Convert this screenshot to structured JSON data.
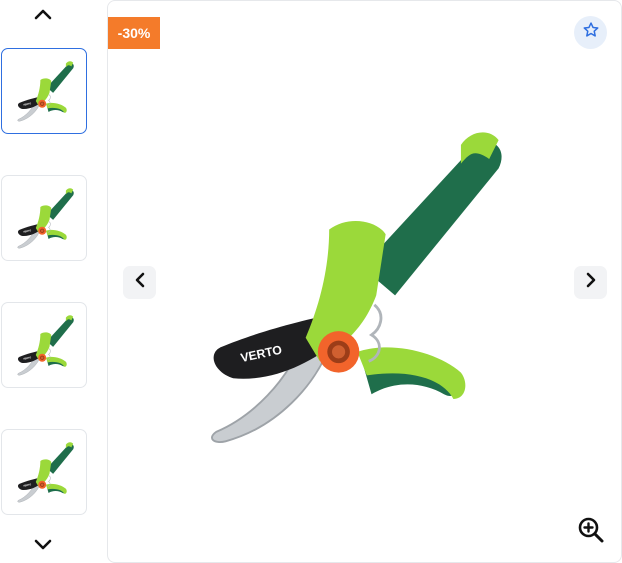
{
  "gallery": {
    "discount_badge": "-30%",
    "brand_text": "VERTO",
    "thumbnail_count": 4,
    "active_thumbnail": 1,
    "icons": {
      "thumb_up": "chevron-up-icon",
      "thumb_down": "chevron-down-icon",
      "prev": "chevron-left-icon",
      "next": "chevron-right-icon",
      "favorite": "star-icon",
      "zoom": "zoom-in-icon"
    },
    "colors": {
      "badge": "#f47b2a",
      "accent": "#2f6fe0",
      "handle_green": "#1f6e4b",
      "lime": "#9bd93a",
      "knob_orange": "#f2642b"
    }
  }
}
